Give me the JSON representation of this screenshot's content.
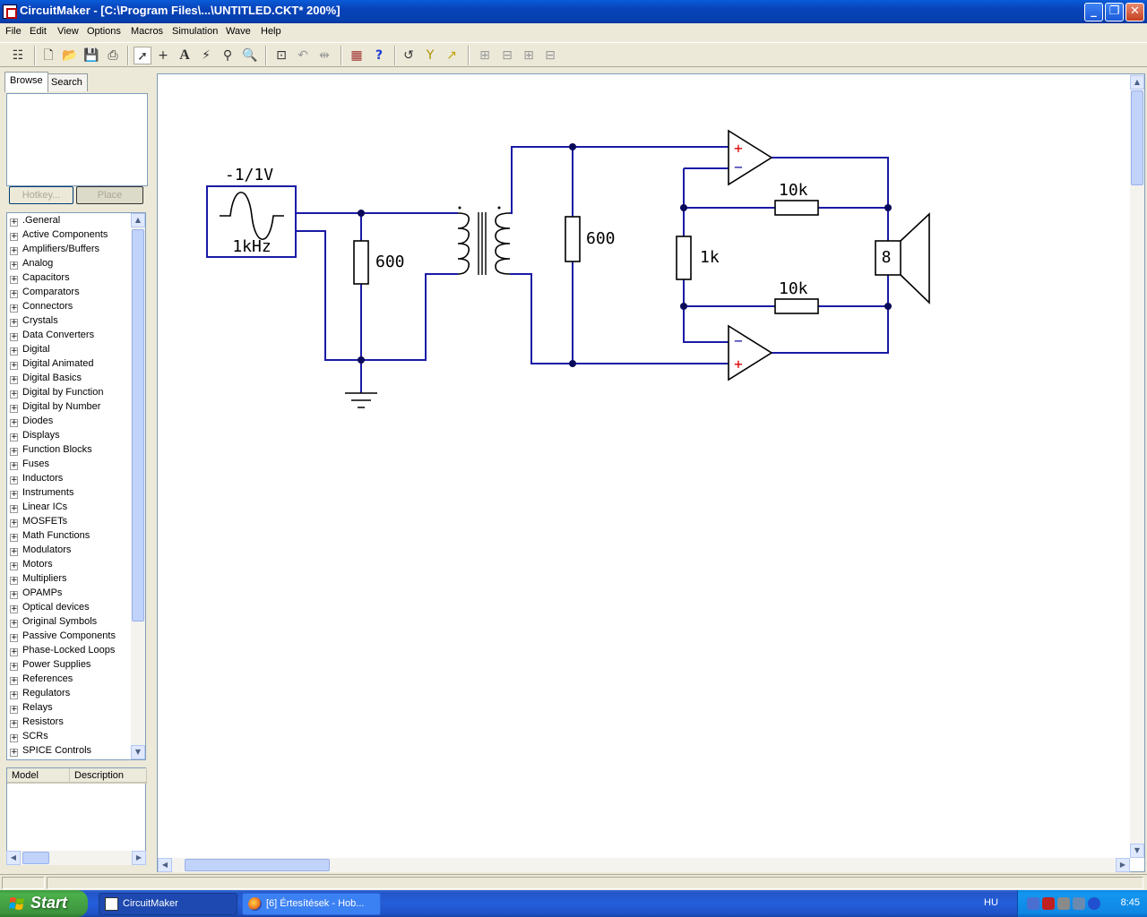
{
  "window": {
    "title": "CircuitMaker - [C:\\Program Files\\...\\UNTITLED.CKT* 200%]",
    "minimize": "_",
    "restore": "❐",
    "close": "✕"
  },
  "menu": [
    "File",
    "Edit",
    "View",
    "Options",
    "Macros",
    "Simulation",
    "Wave",
    "Help"
  ],
  "toolbar": {
    "icons": [
      "hierarchy-icon",
      "new-file-icon",
      "open-file-icon",
      "save-icon",
      "print-icon",
      "arrow-tool-icon",
      "wire-tool-icon",
      "text-tool-icon",
      "probe-tool-icon",
      "zoom-tool-icon",
      "fit-icon",
      "rotate-icon",
      "mirror-icon",
      "bom-icon",
      "help-icon",
      "undo-icon",
      "pin-icon",
      "run-icon"
    ]
  },
  "left_panel": {
    "tabs": [
      "Browse",
      "Search"
    ],
    "hotkey_button": "Hotkey...",
    "place_button": "Place",
    "categories": [
      ".General",
      "Active Components",
      "Amplifiers/Buffers",
      "Analog",
      "Capacitors",
      "Comparators",
      "Connectors",
      "Crystals",
      "Data Converters",
      "Digital",
      "Digital Animated",
      "Digital Basics",
      "Digital by Function",
      "Digital by Number",
      "Diodes",
      "Displays",
      "Function Blocks",
      "Fuses",
      "Inductors",
      "Instruments",
      "Linear ICs",
      "MOSFETs",
      "Math Functions",
      "Modulators",
      "Motors",
      "Multipliers",
      "OPAMPs",
      "Optical devices",
      "Original Symbols",
      "Passive Components",
      "Phase-Locked Loops",
      "Power Supplies",
      "References",
      "Regulators",
      "Relays",
      "Resistors",
      "SCRs",
      "SPICE Controls"
    ],
    "model_columns": [
      "Model",
      "Description"
    ]
  },
  "schematic": {
    "source_voltage": "-1/1V",
    "source_frequency": "1kHz",
    "r_input": "600",
    "r_secondary": "600",
    "r_feedback_top": "10k",
    "r_middle": "1k",
    "r_feedback_bottom": "10k",
    "speaker": "8",
    "plus": "+",
    "minus": "−",
    "wire_color": "#1a1aa6",
    "node_color": "#0a0a5a"
  },
  "taskbar": {
    "start": "Start",
    "tasks": [
      "CircuitMaker",
      "[6] Értesítések - Hob..."
    ],
    "language": "HU",
    "time": "8:45"
  }
}
